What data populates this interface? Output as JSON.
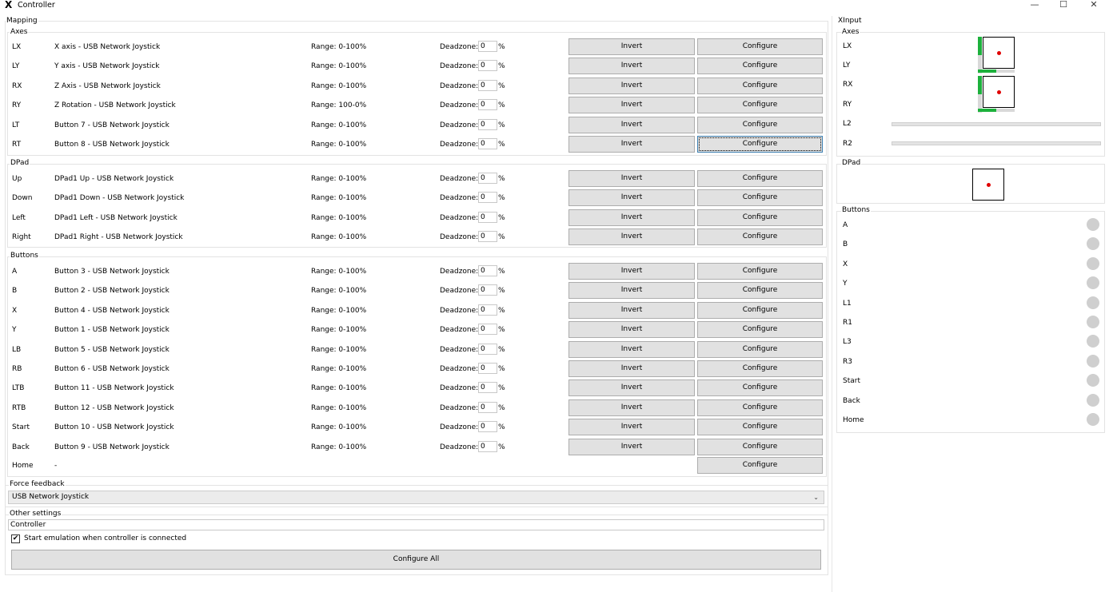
{
  "window": {
    "title": "Controller",
    "minimize": "—",
    "maximize": "☐",
    "close": "✕"
  },
  "mapping": {
    "label": "Mapping",
    "axes_label": "Axes",
    "dpad_label": "DPad",
    "buttons_label": "Buttons",
    "deadzone_label": "Deadzone:",
    "percent": "%",
    "invert_label": "Invert",
    "configure_label": "Configure",
    "axes": [
      {
        "code": "LX",
        "source": "X axis - USB Network Joystick",
        "range": "Range: 0-100%",
        "deadzone": "0"
      },
      {
        "code": "LY",
        "source": "Y axis - USB Network Joystick",
        "range": "Range: 0-100%",
        "deadzone": "0"
      },
      {
        "code": "RX",
        "source": "Z Axis - USB Network Joystick",
        "range": "Range: 0-100%",
        "deadzone": "0"
      },
      {
        "code": "RY",
        "source": "Z Rotation - USB Network Joystick",
        "range": "Range: 100-0%",
        "deadzone": "0"
      },
      {
        "code": "LT",
        "source": "Button 7 - USB Network Joystick",
        "range": "Range: 0-100%",
        "deadzone": "0"
      },
      {
        "code": "RT",
        "source": "Button 8 - USB Network Joystick",
        "range": "Range: 0-100%",
        "deadzone": "0"
      }
    ],
    "dpad": [
      {
        "code": "Up",
        "source": "DPad1 Up - USB Network Joystick",
        "range": "Range: 0-100%",
        "deadzone": "0"
      },
      {
        "code": "Down",
        "source": "DPad1 Down - USB Network Joystick",
        "range": "Range: 0-100%",
        "deadzone": "0"
      },
      {
        "code": "Left",
        "source": "DPad1 Left - USB Network Joystick",
        "range": "Range: 0-100%",
        "deadzone": "0"
      },
      {
        "code": "Right",
        "source": "DPad1 Right - USB Network Joystick",
        "range": "Range: 0-100%",
        "deadzone": "0"
      }
    ],
    "buttons": [
      {
        "code": "A",
        "source": "Button 3 - USB Network Joystick",
        "range": "Range: 0-100%",
        "deadzone": "0"
      },
      {
        "code": "B",
        "source": "Button 2 - USB Network Joystick",
        "range": "Range: 0-100%",
        "deadzone": "0"
      },
      {
        "code": "X",
        "source": "Button 4 - USB Network Joystick",
        "range": "Range: 0-100%",
        "deadzone": "0"
      },
      {
        "code": "Y",
        "source": "Button 1 - USB Network Joystick",
        "range": "Range: 0-100%",
        "deadzone": "0"
      },
      {
        "code": "LB",
        "source": "Button 5 - USB Network Joystick",
        "range": "Range: 0-100%",
        "deadzone": "0"
      },
      {
        "code": "RB",
        "source": "Button 6 - USB Network Joystick",
        "range": "Range: 0-100%",
        "deadzone": "0"
      },
      {
        "code": "LTB",
        "source": "Button 11 - USB Network Joystick",
        "range": "Range: 0-100%",
        "deadzone": "0"
      },
      {
        "code": "RTB",
        "source": "Button 12 - USB Network Joystick",
        "range": "Range: 0-100%",
        "deadzone": "0"
      },
      {
        "code": "Start",
        "source": "Button 10 - USB Network Joystick",
        "range": "Range: 0-100%",
        "deadzone": "0"
      },
      {
        "code": "Back",
        "source": "Button 9 - USB Network Joystick",
        "range": "Range: 0-100%",
        "deadzone": "0"
      }
    ],
    "home": {
      "code": "Home",
      "source": "-"
    }
  },
  "force_feedback": {
    "label": "Force feedback",
    "selected": "USB Network Joystick"
  },
  "other_settings": {
    "label": "Other settings",
    "name_value": "Controller",
    "start_emulation_label": "Start emulation when controller is connected",
    "start_emulation_checked": true,
    "configure_all_label": "Configure All"
  },
  "xinput": {
    "label": "XInput",
    "axes_label": "Axes",
    "axis_names": [
      "LX",
      "LY",
      "RX",
      "RY",
      "L2",
      "R2"
    ],
    "dpad_label": "DPad",
    "buttons_label": "Buttons",
    "button_names": [
      "A",
      "B",
      "X",
      "Y",
      "L1",
      "R1",
      "L3",
      "R3",
      "Start",
      "Back",
      "Home"
    ]
  }
}
